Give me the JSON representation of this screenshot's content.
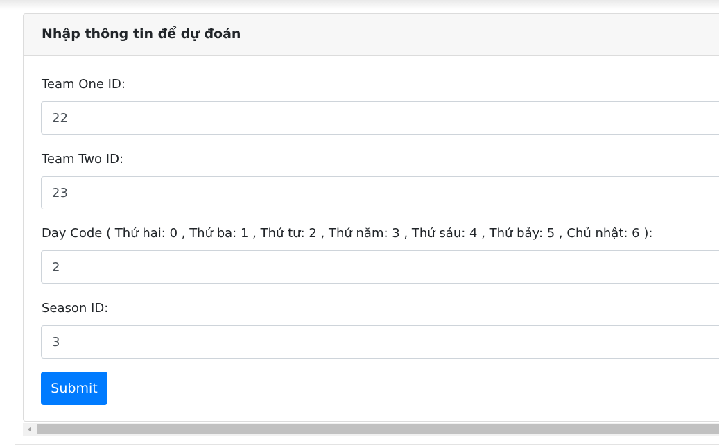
{
  "card": {
    "title": "Nhập thông tin để dự đoán"
  },
  "form": {
    "team_one": {
      "label": "Team One ID:",
      "value": "22"
    },
    "team_two": {
      "label": "Team Two ID:",
      "value": "23"
    },
    "day_code": {
      "label": "Day Code ( Thứ hai: 0 , Thứ ba: 1 , Thứ tư: 2 , Thứ năm: 3 , Thứ sáu: 4 , Thứ bảy: 5 , Chủ nhật: 6 ):",
      "value": "2"
    },
    "season": {
      "label": "Season ID:",
      "value": "3"
    },
    "submit_label": "Submit"
  },
  "colors": {
    "primary_button": "#007bff",
    "header_background": "#f7f7f7",
    "scrollbar_thumb": "#c1c1c1"
  },
  "icons": {
    "scroll_left": "triangle-left-icon"
  }
}
